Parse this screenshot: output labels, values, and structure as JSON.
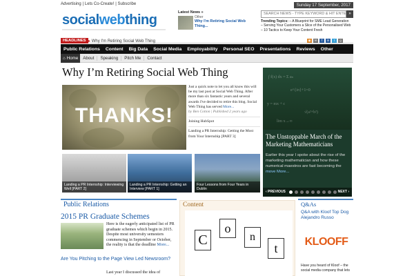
{
  "topbar": {
    "links": [
      "Advertising",
      "Lets Co-Create!",
      "Subscribe"
    ],
    "date": "Sunday 17 September, 2017"
  },
  "logo": {
    "part1": "social",
    "part2": "web",
    "part3": "thing"
  },
  "latest_news": {
    "label": "Latest News »",
    "category": "Other",
    "title": "Why I'm Retiring Social Web Thing..."
  },
  "search": {
    "placeholder": "SEARCH NEWS - TYPE KEYWORD & HIT ENTER",
    "button": "»"
  },
  "trending": {
    "label": "Trending Topics:",
    "items": [
      "– A Blueprint for SME Lead Generation",
      "– Serving Your Customers a Slice of the Personalised Web",
      "– 10 Tactics to Keep Your Content Fresh"
    ]
  },
  "social_icons": [
    "rss-icon",
    "email-icon",
    "facebook-icon",
    "linkedin-icon",
    "twitter-icon",
    "googleplus-icon"
  ],
  "headline": {
    "tag": "HEADLINES",
    "text": "Why I'm Retiring Social Web Thing"
  },
  "nav": [
    "Public Relations",
    "Content",
    "Big Data",
    "Social Media",
    "Employability",
    "Personal SEO",
    "Presentations",
    "Reviews",
    "Other"
  ],
  "subnav": [
    "Home",
    "About",
    "Speaking",
    "Pitch Me",
    "Contact"
  ],
  "main": {
    "title": "Why I’m Retiring Social Web Thing",
    "image_text": "THANKS!",
    "excerpt": "Just a quick note to let you all know this will be my last post at Social Web Thing. After more than six fantastic years and several awards I've decided to retire this blog. Social Web Thing has served",
    "more": "More...",
    "meta": "by Ben Cotton | Published 2 years ago",
    "related": [
      "Joining HubSpot",
      "Landing a PR Internship: Getting the Most from Your Internship [PART 3]"
    ]
  },
  "slider": {
    "title": "The Unstoppable March of the Marketing Mathematicians",
    "text": "Earlier this year I spoke about the rise of the marketing mathematician and how these numerical maestros are fast becoming the",
    "more": "move More...",
    "prev": "‹ PREVIOUS",
    "next": "NEXT ›",
    "dots": 9,
    "active": 0
  },
  "thumbs": [
    {
      "caption": "Landing a PR Internship: Interviewing Well [PART 2]"
    },
    {
      "caption": "Landing a PR Internship: Getting an Interview [PART 1]"
    },
    {
      "caption": "Four Lessons from Four Years in Dublin"
    }
  ],
  "public_relations": {
    "section": "Public Relations",
    "headline": "2015 PR Graduate Schemes",
    "text": "Here is the eagerly anticipated list of PR graduate schemes which begin in 2015. Despite most university semesters commencing in September or October, the reality is that the deadline",
    "more": "More...",
    "headline2": "Are You Pitching to the Page View Led Newsroom?",
    "text2": "Last year I discussed the idea of"
  },
  "content_section": {
    "section": "Content",
    "cards": [
      "C",
      "o",
      "n",
      "t"
    ]
  },
  "qa": {
    "section": "Q&As",
    "link": "Q&A with Kloof Top Dog Alejandro Russo",
    "logo": "KLOOFF",
    "text": "Have you heard of Kloof – the social media company that lets"
  },
  "colors": {
    "accent": "#1a5aa6",
    "nav_bg": "#111111",
    "headline_tag": "#c11b1b",
    "content": "#a06820",
    "kloof": "#e35b17"
  }
}
